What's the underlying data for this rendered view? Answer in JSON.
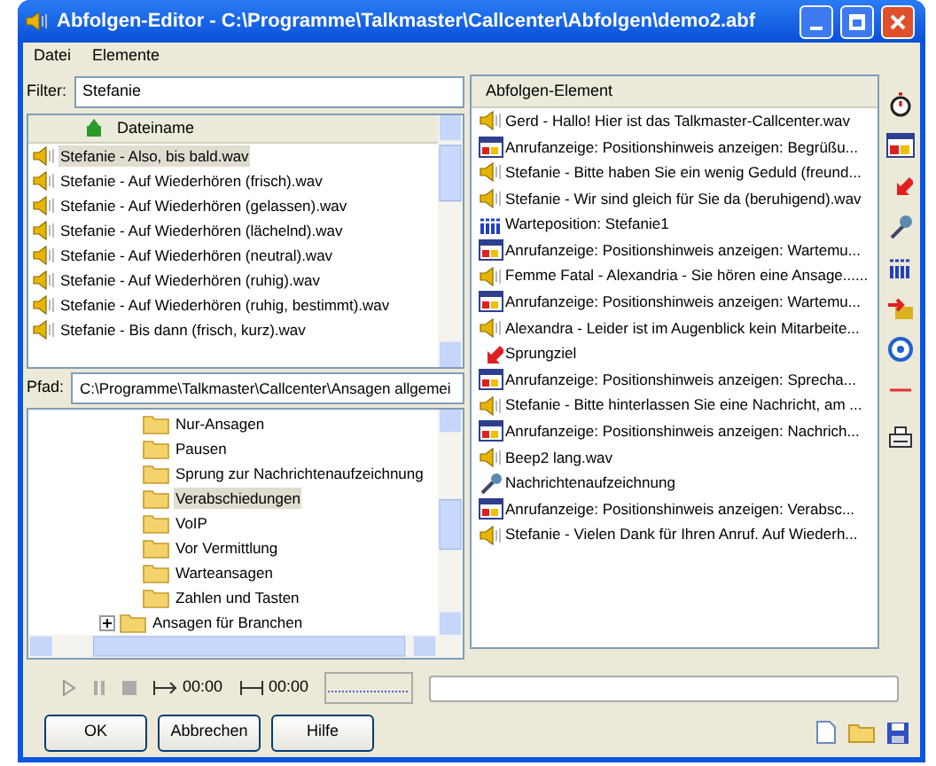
{
  "window": {
    "title": "Abfolgen-Editor - C:\\Programme\\Talkmaster\\Callcenter\\Abfolgen\\demo2.abf"
  },
  "menu": [
    "Datei",
    "Elemente"
  ],
  "filter": {
    "label": "Filter:",
    "value": "Stefanie"
  },
  "file_list": {
    "column": "Dateiname",
    "rows": [
      {
        "name": "Stefanie - Also, bis bald.wav",
        "selected": true
      },
      {
        "name": "Stefanie - Auf Wiederhören (frisch).wav",
        "selected": false
      },
      {
        "name": "Stefanie - Auf Wiederhören (gelassen).wav",
        "selected": false
      },
      {
        "name": "Stefanie - Auf Wiederhören (lächelnd).wav",
        "selected": false
      },
      {
        "name": "Stefanie - Auf Wiederhören (neutral).wav",
        "selected": false
      },
      {
        "name": "Stefanie - Auf Wiederhören (ruhig).wav",
        "selected": false
      },
      {
        "name": "Stefanie - Auf Wiederhören (ruhig, bestimmt).wav",
        "selected": false
      },
      {
        "name": "Stefanie - Bis dann (frisch, kurz).wav",
        "selected": false
      }
    ]
  },
  "path": {
    "label": "Pfad:",
    "value": "C:\\Programme\\Talkmaster\\Callcenter\\Ansagen allgemei"
  },
  "tree": {
    "nested_items": [
      {
        "label": "Nur-Ansagen",
        "selected": false
      },
      {
        "label": "Pausen",
        "selected": false
      },
      {
        "label": "Sprung zur Nachrichtenaufzeichnung",
        "selected": false
      },
      {
        "label": "Verabschiedungen",
        "selected": true
      },
      {
        "label": "VoIP",
        "selected": false
      },
      {
        "label": "Vor Vermittlung",
        "selected": false
      },
      {
        "label": "Warteansagen",
        "selected": false
      },
      {
        "label": "Zahlen und Tasten",
        "selected": false
      }
    ],
    "items": [
      {
        "label": "Ansagen für Branchen",
        "expanded": false,
        "selected": false
      }
    ]
  },
  "player": {
    "position": "00:00",
    "length": "00:00"
  },
  "buttons": [
    "OK",
    "Abbrechen",
    "Hilfe"
  ],
  "sequence": {
    "column": "Abfolgen-Element",
    "rows": [
      {
        "kind": "sound",
        "text": "Gerd - Hallo! Hier ist das Talkmaster-Callcenter.wav"
      },
      {
        "kind": "display",
        "text": "Anrufanzeige: Positionshinweis anzeigen: Begrüßu..."
      },
      {
        "kind": "sound",
        "text": "Stefanie - Bitte haben Sie ein wenig Geduld (freund..."
      },
      {
        "kind": "sound",
        "text": "Stefanie - Wir sind gleich für Sie da (beruhigend).wav"
      },
      {
        "kind": "queue",
        "text": "Warteposition: Stefanie1"
      },
      {
        "kind": "display",
        "text": "Anrufanzeige: Positionshinweis anzeigen: Wartemu..."
      },
      {
        "kind": "sound",
        "text": "Femme Fatal - Alexandria - Sie hören eine Ansage......"
      },
      {
        "kind": "display",
        "text": "Anrufanzeige: Positionshinweis anzeigen: Wartemu..."
      },
      {
        "kind": "sound",
        "text": "Alexandra - Leider ist im Augenblick kein Mitarbeite..."
      },
      {
        "kind": "jump",
        "text": "Sprungziel"
      },
      {
        "kind": "display",
        "text": "Anrufanzeige: Positionshinweis anzeigen: Sprecha..."
      },
      {
        "kind": "sound",
        "text": "Stefanie - Bitte hinterlassen Sie eine Nachricht, am ..."
      },
      {
        "kind": "display",
        "text": "Anrufanzeige: Positionshinweis anzeigen: Nachrich..."
      },
      {
        "kind": "sound",
        "text": "Beep2 lang.wav"
      },
      {
        "kind": "record",
        "text": "Nachrichtenaufzeichnung"
      },
      {
        "kind": "display",
        "text": "Anrufanzeige: Positionshinweis anzeigen: Verabsc..."
      },
      {
        "kind": "sound",
        "text": "Stefanie - Vielen Dank für Ihren Anruf. Auf Wiederh..."
      }
    ]
  }
}
